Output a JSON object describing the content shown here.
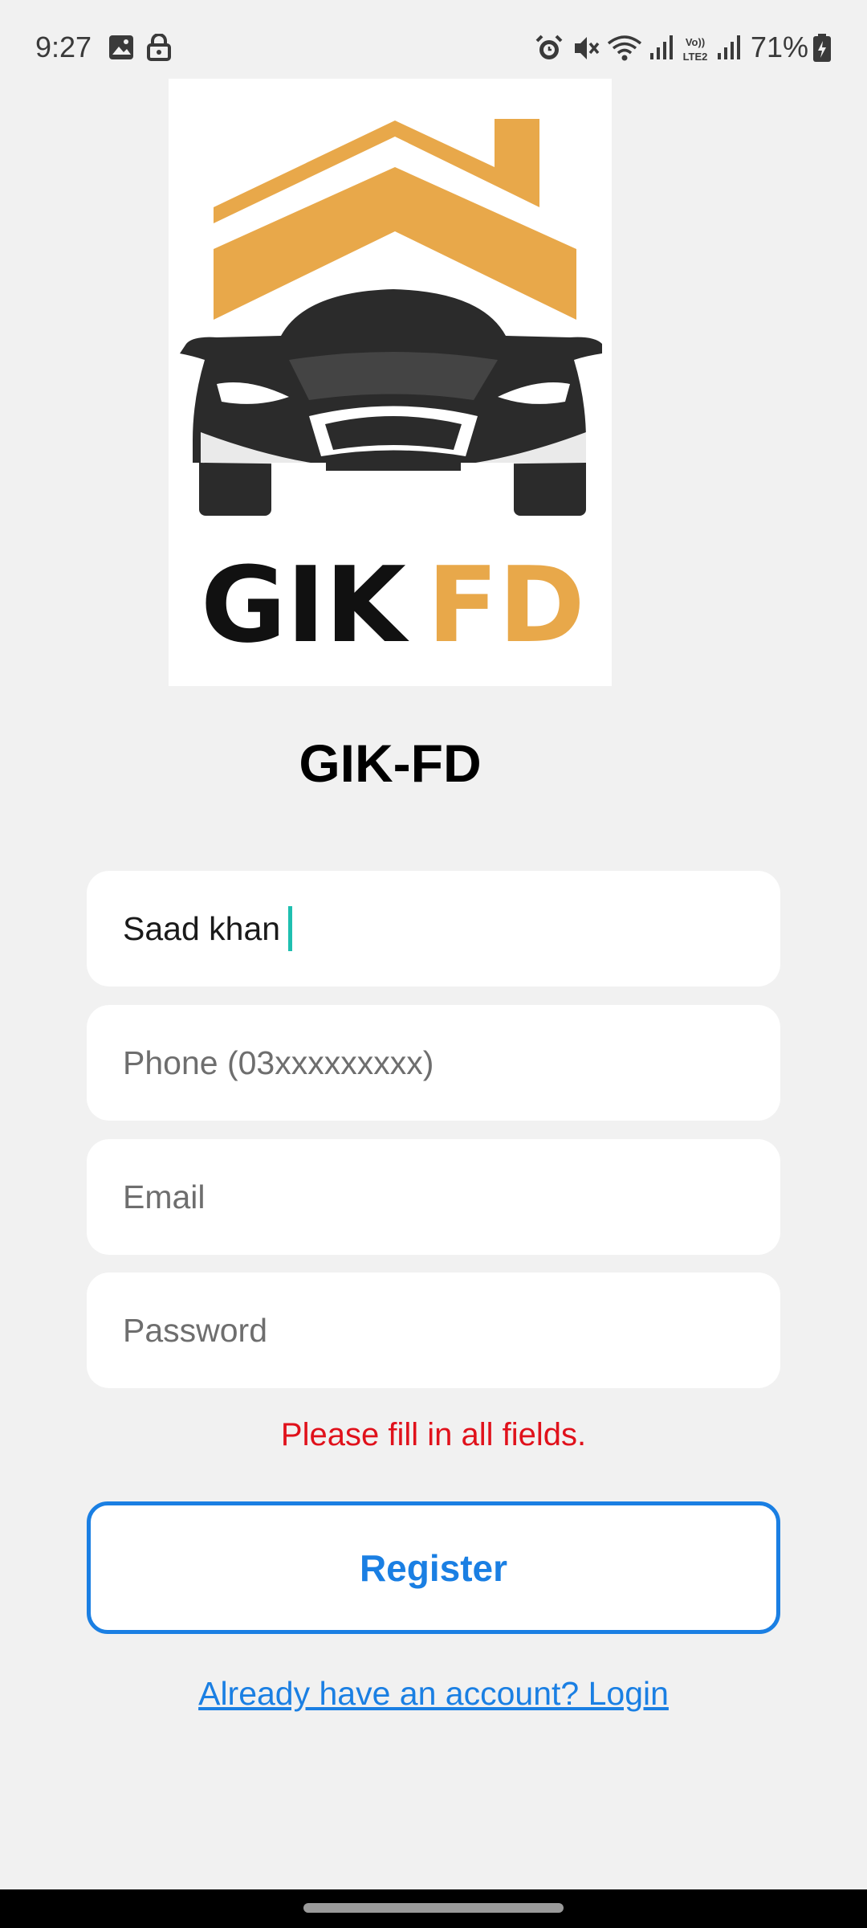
{
  "status_bar": {
    "time": "9:27",
    "battery": "71%",
    "icons": [
      "image-icon",
      "lock-icon",
      "alarm-icon",
      "mute-icon",
      "wifi-icon",
      "signal-icon",
      "volte-icon",
      "signal-icon",
      "battery-icon"
    ]
  },
  "logo": {
    "text_left": "GIK",
    "text_right": "FD"
  },
  "app": {
    "title": "GIK-FD"
  },
  "form": {
    "name_value": "Saad khan",
    "phone_placeholder": "Phone (03xxxxxxxxx)",
    "email_placeholder": "Email",
    "password_placeholder": "Password",
    "error": "Please fill in all fields.",
    "register_label": "Register",
    "login_link": "Already have an account? Login"
  },
  "colors": {
    "accent": "#1a7fe3",
    "error": "#e0111b",
    "logo_orange": "#e8a84a",
    "logo_dark": "#2b2b2b",
    "caret": "#1fbfb0"
  }
}
